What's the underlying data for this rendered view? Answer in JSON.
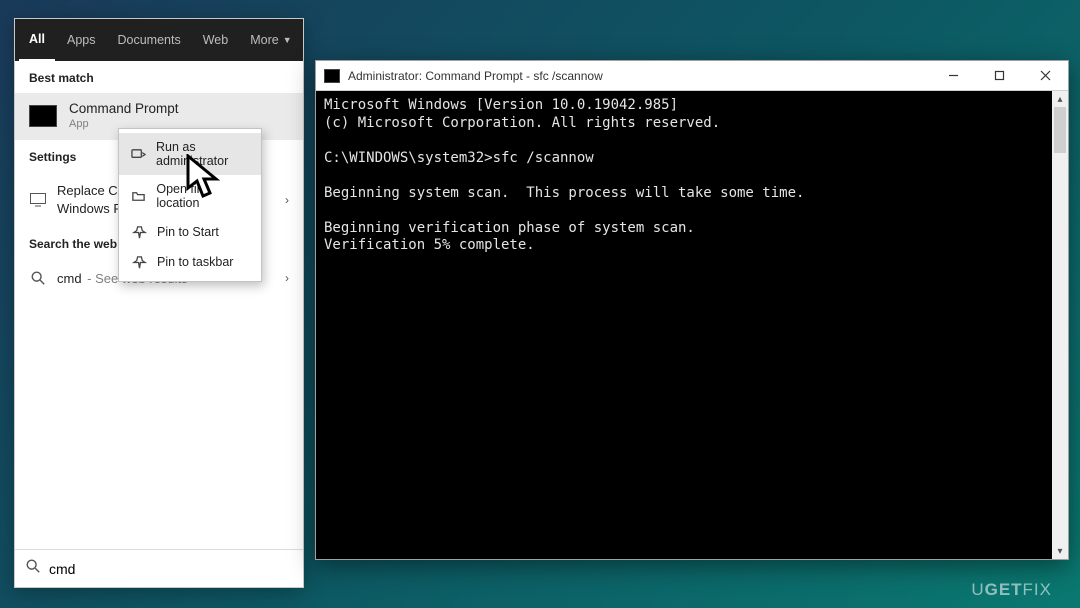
{
  "search": {
    "tabs": {
      "all": "All",
      "apps": "Apps",
      "documents": "Documents",
      "web": "Web",
      "more": "More"
    },
    "best_match_label": "Best match",
    "best_match": {
      "title": "Command Prompt",
      "type": "App"
    },
    "settings_label": "Settings",
    "settings_item": "Replace Command Prompt with\nWindows PowerShell…",
    "search_web_label": "Search the web",
    "web_item_prefix": "cmd",
    "web_item_suffix": " - See web results",
    "input_value": "cmd"
  },
  "context_menu": {
    "run_admin": "Run as administrator",
    "open_location": "Open file location",
    "pin_start": "Pin to Start",
    "pin_taskbar": "Pin to taskbar"
  },
  "cmd": {
    "title": "Administrator: Command Prompt - sfc  /scannow",
    "lines": [
      "Microsoft Windows [Version 10.0.19042.985]",
      "(c) Microsoft Corporation. All rights reserved.",
      "",
      "C:\\WINDOWS\\system32>sfc /scannow",
      "",
      "Beginning system scan.  This process will take some time.",
      "",
      "Beginning verification phase of system scan.",
      "Verification 5% complete."
    ]
  },
  "watermark": "UGETFIX"
}
